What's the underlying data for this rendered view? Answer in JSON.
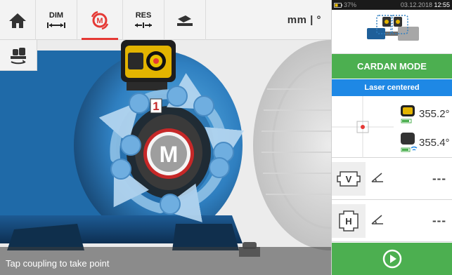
{
  "toolbar": {
    "dim_label": "DIM",
    "res_label": "RES",
    "units_label": "mm | °"
  },
  "viewport": {
    "coupling_point_label": "1",
    "motor_label": "M",
    "status_text": "Tap coupling to take point"
  },
  "panel": {
    "system": {
      "battery": "37%",
      "datetime": "03.12.2018",
      "time": "12:55"
    },
    "mode_label": "CARDAN MODE",
    "laser_status": "Laser centered",
    "sensor_reading_1": "355.2°",
    "sensor_reading_2": "355.4°",
    "vertical_badge": "V",
    "horizontal_badge": "H",
    "vertical_value": "---",
    "horizontal_value": "---"
  },
  "colors": {
    "accent_green": "#4caf50",
    "accent_blue": "#1e88e5",
    "accent_red": "#e53935",
    "machine_blue": "#2f7fc0"
  }
}
